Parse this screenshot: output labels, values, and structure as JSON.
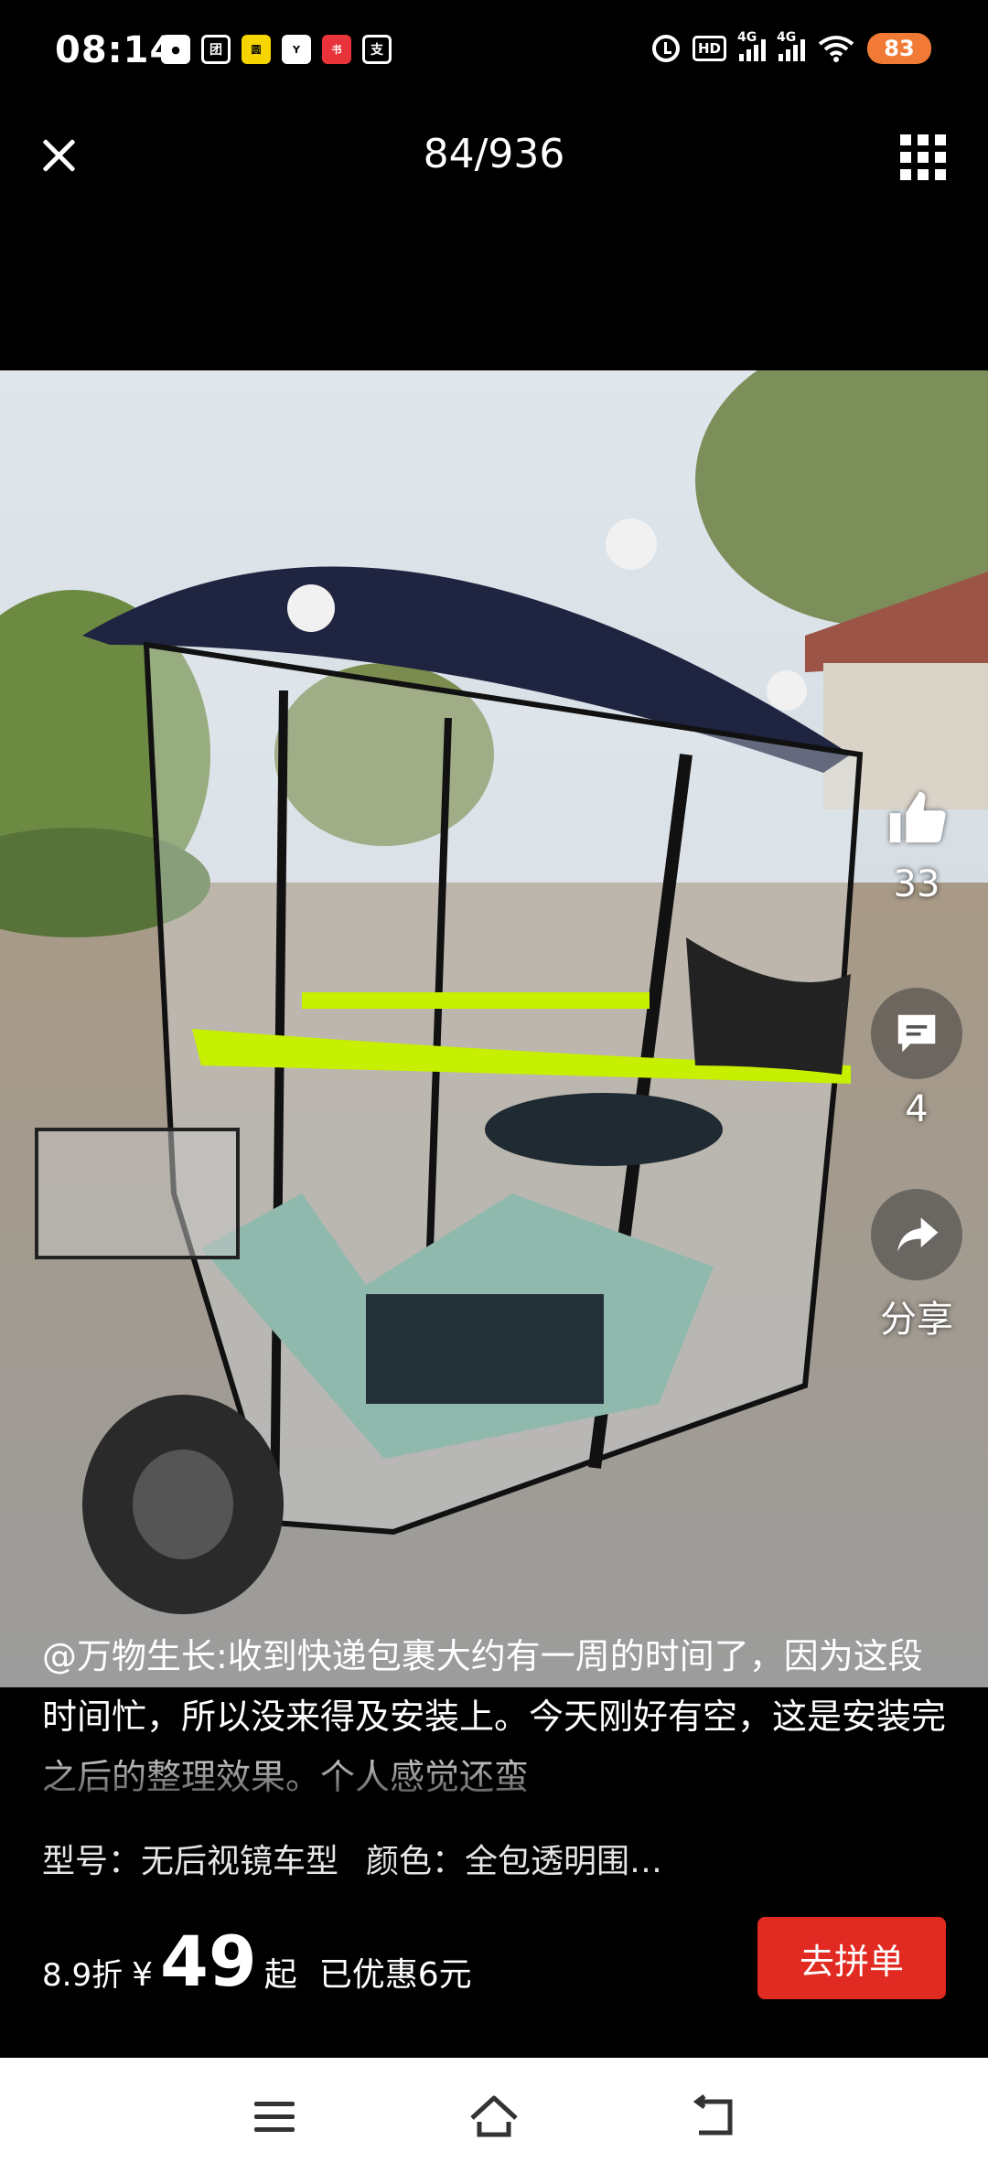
{
  "status_bar": {
    "time": "08:14",
    "notification_icons": [
      "wechat-icon",
      "meituan-icon",
      "yuantu-icon",
      "youku-icon",
      "xiaohongshu-icon",
      "alipay-icon"
    ],
    "hd_label": "HD",
    "network_1": "4G",
    "network_2": "4G",
    "battery": "83"
  },
  "top_bar": {
    "counter": "84/936"
  },
  "actions": {
    "like_count": "33",
    "comment_count": "4",
    "share_label": "分享"
  },
  "caption": "@万物生长:收到快递包裹大约有一周的时间了，因为这段时间忙，所以没来得及安装上。今天刚好有空，这是安装完之后的整理效果。个人感觉还蛮",
  "product": {
    "spec_model": "型号：无后视镜车型",
    "spec_color": "颜色：全包透明围…",
    "discount": "8.9折",
    "currency": "¥",
    "price": "49",
    "price_suffix": "起",
    "saved": "已优惠6元",
    "buy_label": "去拼单"
  },
  "colors": {
    "buy_button": "#e12a21",
    "battery": "#f07a36"
  }
}
